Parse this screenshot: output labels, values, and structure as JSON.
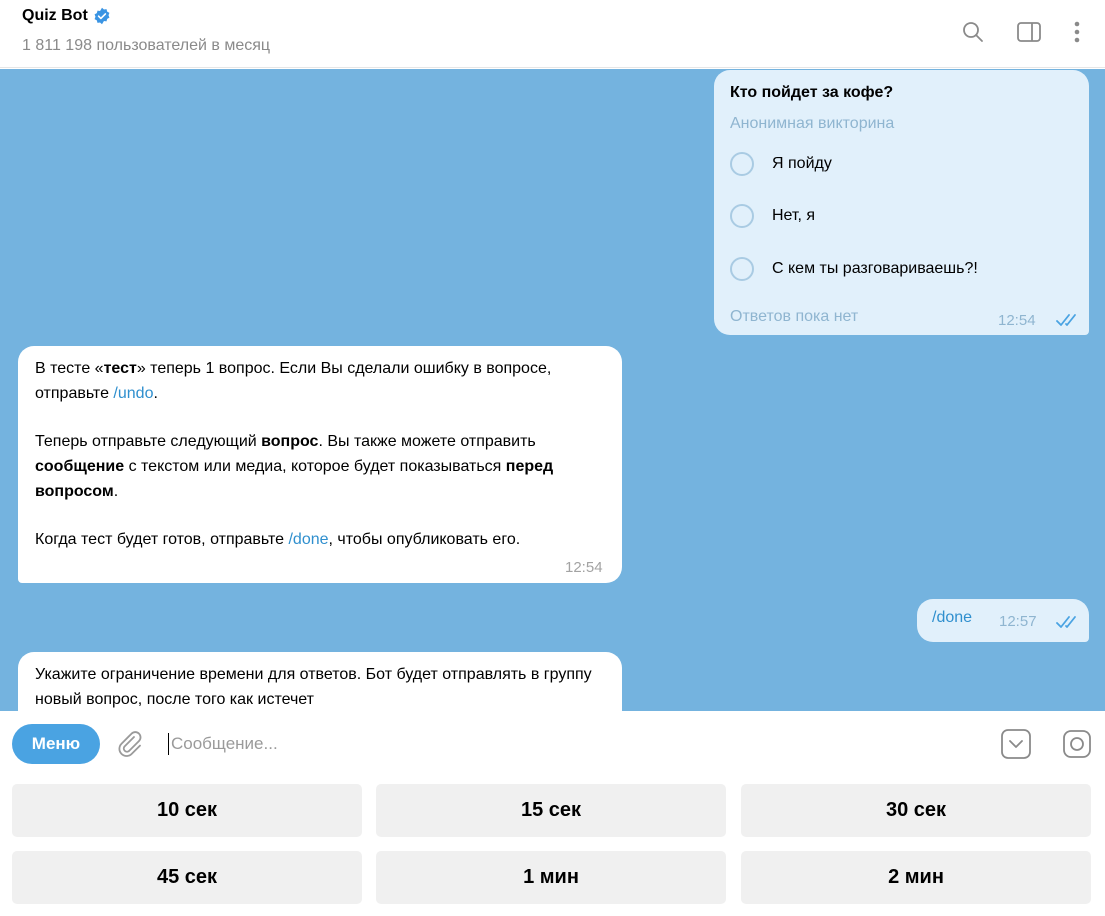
{
  "header": {
    "title": "Quiz Bot",
    "subtitle": "1 811 198 пользователей в месяц",
    "icons": [
      "search-icon",
      "sidebar-toggle-icon",
      "more-vertical-icon"
    ]
  },
  "poll": {
    "question": "Кто пойдет за кофе?",
    "type": "Анонимная викторина",
    "options": [
      "Я пойду",
      "Нет, я",
      "С кем ты разговариваешь?!"
    ],
    "footer": "Ответов пока нет",
    "time": "12:54"
  },
  "message1": {
    "p1_a": "В тесте «",
    "p1_b": "тест",
    "p1_c": "» теперь 1 вопрос. Если Вы сделали ошибку в вопросе, отправьте ",
    "p1_cmd": "/undo",
    "p1_d": ".",
    "p2_a": "Теперь отправьте следующий ",
    "p2_b": "вопрос",
    "p2_c": ". Вы также можете отправить ",
    "p2_d": "сообщение",
    "p2_e": " с текстом или медиа, которое будет показываться ",
    "p2_f": "перед вопросом",
    "p2_g": ".",
    "p3_a": "Когда тест будет готов, отправьте ",
    "p3_cmd": "/done",
    "p3_b": ", чтобы опубликовать его.",
    "time": "12:54"
  },
  "outgoing_done": {
    "text": "/done",
    "time": "12:57"
  },
  "message2": {
    "text": "Укажите ограничение времени для ответов. Бот будет отправлять в группу новый вопрос, после того как истечет"
  },
  "input": {
    "menu_label": "Меню",
    "placeholder": "Сообщение..."
  },
  "keyboard": {
    "buttons": [
      "10 сек",
      "15 сек",
      "30 сек",
      "45 сек",
      "1 мин",
      "2 мин"
    ]
  },
  "colors": {
    "chat_background": "#74b3df",
    "outgoing_bubble": "#e1f0fb",
    "accent": "#4aa3e2",
    "link": "#2f8fce"
  }
}
